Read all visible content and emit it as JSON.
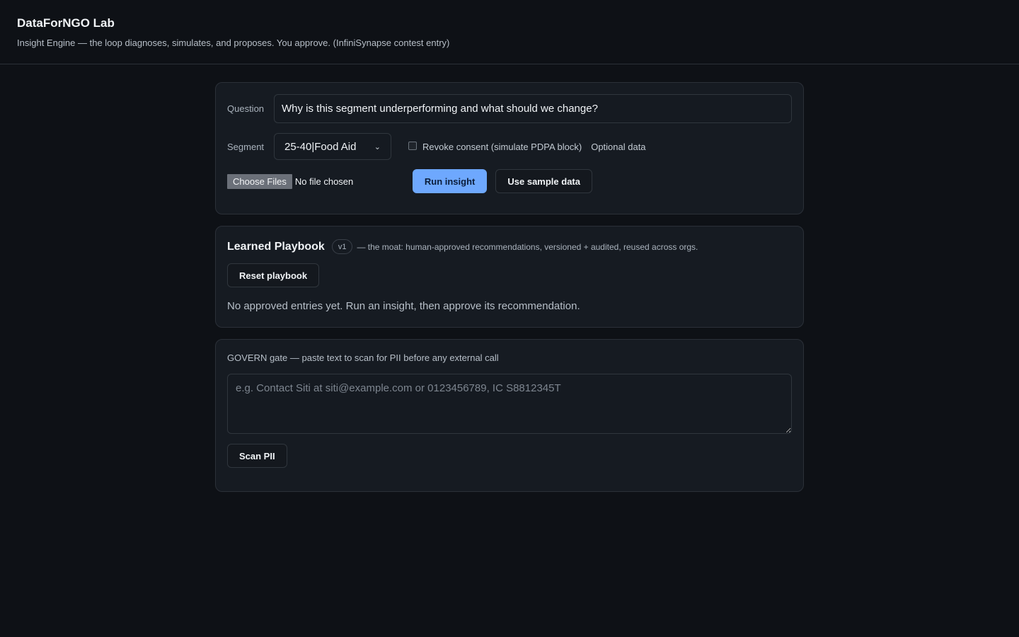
{
  "header": {
    "title": "DataForNGO Lab",
    "subtitle": "Insight Engine — the loop diagnoses, simulates, and proposes. You approve. (InfiniSynapse contest entry)"
  },
  "query": {
    "question_label": "Question",
    "question_value": "Why is this segment underperforming and what should we change?",
    "segment_label": "Segment",
    "segment_value": "25-40|Food Aid",
    "consent_label": "Revoke consent (simulate PDPA block)",
    "consent_checked": false,
    "optional_label": "Optional data",
    "file_button": "Choose Files",
    "file_status": "No file chosen",
    "run_button": "Run insight",
    "sample_button": "Use sample data"
  },
  "playbook": {
    "title": "Learned Playbook",
    "version": "v1",
    "description": "— the moat: human-approved recommendations, versioned + audited, reused across orgs.",
    "reset_button": "Reset playbook",
    "empty_message": "No approved entries yet. Run an insight, then approve its recommendation."
  },
  "govern": {
    "label": "GOVERN gate — paste text to scan for PII before any external call",
    "placeholder": "e.g. Contact Siti at siti@example.com or 0123456789, IC S8812345T",
    "value": "",
    "scan_button": "Scan PII"
  },
  "colors": {
    "background": "#0e1116",
    "card": "#161b22",
    "accent": "#6ea8fe",
    "border": "#2b3038"
  }
}
